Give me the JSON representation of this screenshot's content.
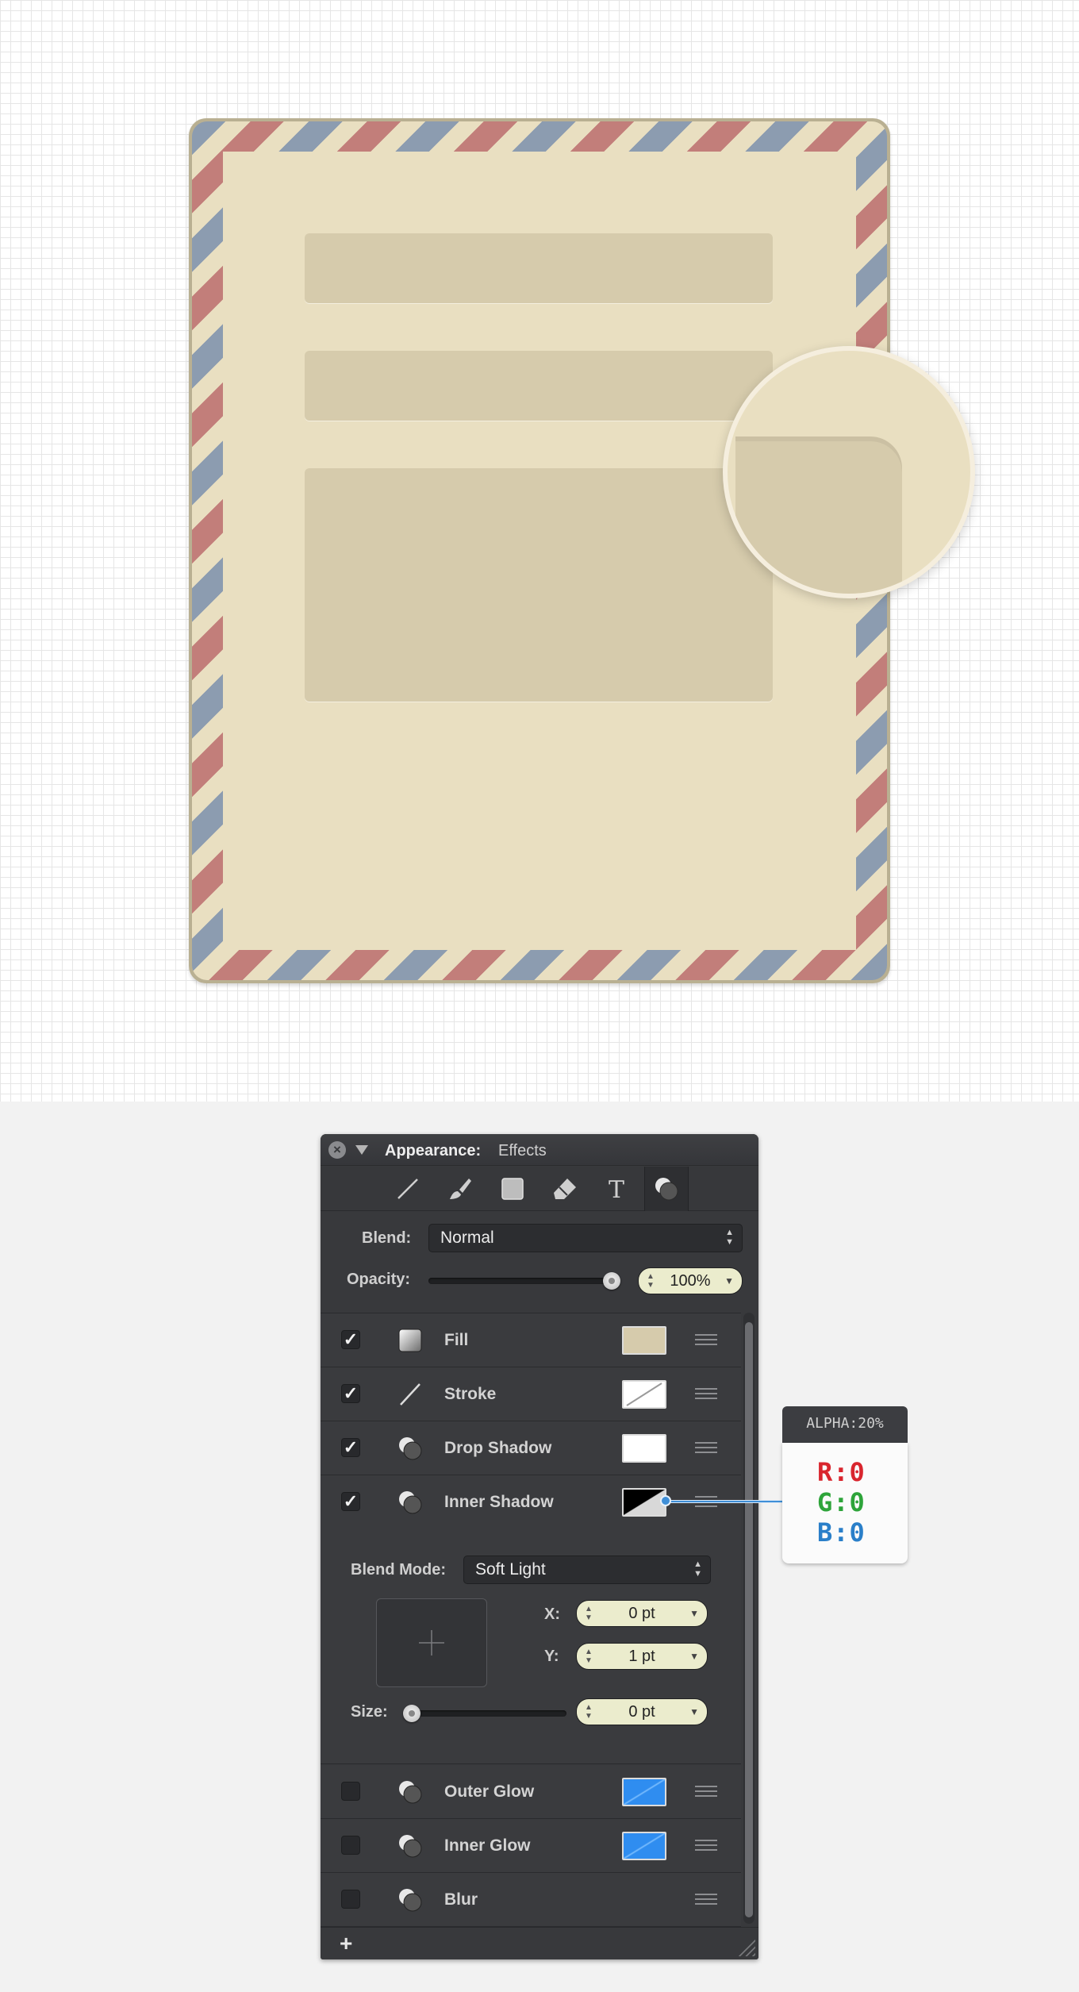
{
  "panel": {
    "header_title": "Appearance:",
    "header_subtitle": "Effects",
    "tools": [
      "stroke-tool-icon",
      "brush-tool-icon",
      "fill-tool-icon",
      "eraser-tool-icon",
      "text-tool-icon",
      "effects-tool-icon"
    ],
    "blend_label": "Blend:",
    "blend_value": "Normal",
    "opacity_label": "Opacity:",
    "opacity_value": "100%",
    "opacity_level": 1.0,
    "effects": [
      {
        "label": "Fill",
        "checked": true,
        "swatch": "#d6cbac"
      },
      {
        "label": "Stroke",
        "checked": true,
        "swatch": "white-slash"
      },
      {
        "label": "Drop Shadow",
        "checked": true,
        "swatch": "#ffffff"
      },
      {
        "label": "Inner Shadow",
        "checked": true,
        "swatch": "black-white-diagonal"
      },
      {
        "label": "Outer Glow",
        "checked": false,
        "swatch": "#2f8df0"
      },
      {
        "label": "Inner Glow",
        "checked": false,
        "swatch": "#2f8df0"
      },
      {
        "label": "Blur",
        "checked": false,
        "swatch": ""
      }
    ],
    "inner_shadow": {
      "blend_mode_label": "Blend Mode:",
      "blend_mode_value": "Soft Light",
      "x_label": "X:",
      "x_value": "0 pt",
      "y_label": "Y:",
      "y_value": "1 pt",
      "size_label": "Size:",
      "size_value": "0 pt",
      "size_level": 0
    },
    "add_label": "+",
    "check_mark": "✓"
  },
  "callout": {
    "alpha": "ALPHA:20%",
    "r": "R:0",
    "g": "G:0",
    "b": "B:0"
  },
  "colors": {
    "envelope": "#e9dfc1",
    "field": "#d6cbac",
    "stripe_blue": "#8c9cb0",
    "stripe_red": "#c27e7a",
    "panel_bg": "#38393c",
    "accent_blue": "#3f8fd8"
  }
}
